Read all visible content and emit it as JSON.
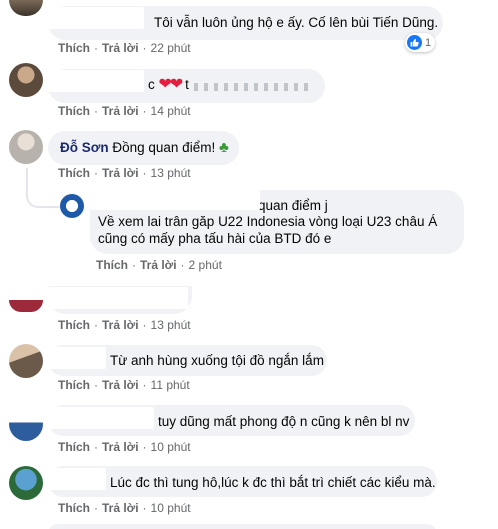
{
  "actions": {
    "like": "Thích",
    "reply": "Trả lời",
    "separator": "·"
  },
  "comments": [
    {
      "text": "Tôi vẫn luôn ủng hộ e ấy. Cố lên bùi Tiến Dũng.",
      "time": "22 phút",
      "reaction_count": "1"
    },
    {
      "text": "c",
      "hearts": "❤️❤️",
      "tail": "t",
      "time": "14 phút"
    },
    {
      "author": "Đỗ Sơn",
      "text": "Đồng quan điểm!",
      "emoji": "🍀",
      "time": "13 phút"
    },
    {
      "line1": "quan điểm j",
      "line2": "Về xem lai trân găp U22 Indonesia vòng loại U23 châu Á",
      "line3": "cũng có mấy pha tấu hài của BTD đó e",
      "time": "2 phút"
    },
    {
      "text": "",
      "time": "13 phút"
    },
    {
      "text": "Từ anh hùng xuống tội đồ ngắn lắm",
      "time": "11 phút"
    },
    {
      "text": "tuy dũng mất phong độ n cũng k nên bl nv",
      "time": "10 phút"
    },
    {
      "text": "Lúc đc thì tung hô,lúc k đc thì bắt trì chiết các kiểu mà.",
      "time": "10 phút"
    }
  ],
  "colors": {
    "bubble": "#f0f2f5",
    "meta": "#65676b",
    "author": "#1c2b6e",
    "like_blue": "#1877f2",
    "heart": "#e41e3f"
  },
  "icons": [
    "thumbs-up-icon",
    "heart-icon",
    "clover-icon"
  ]
}
